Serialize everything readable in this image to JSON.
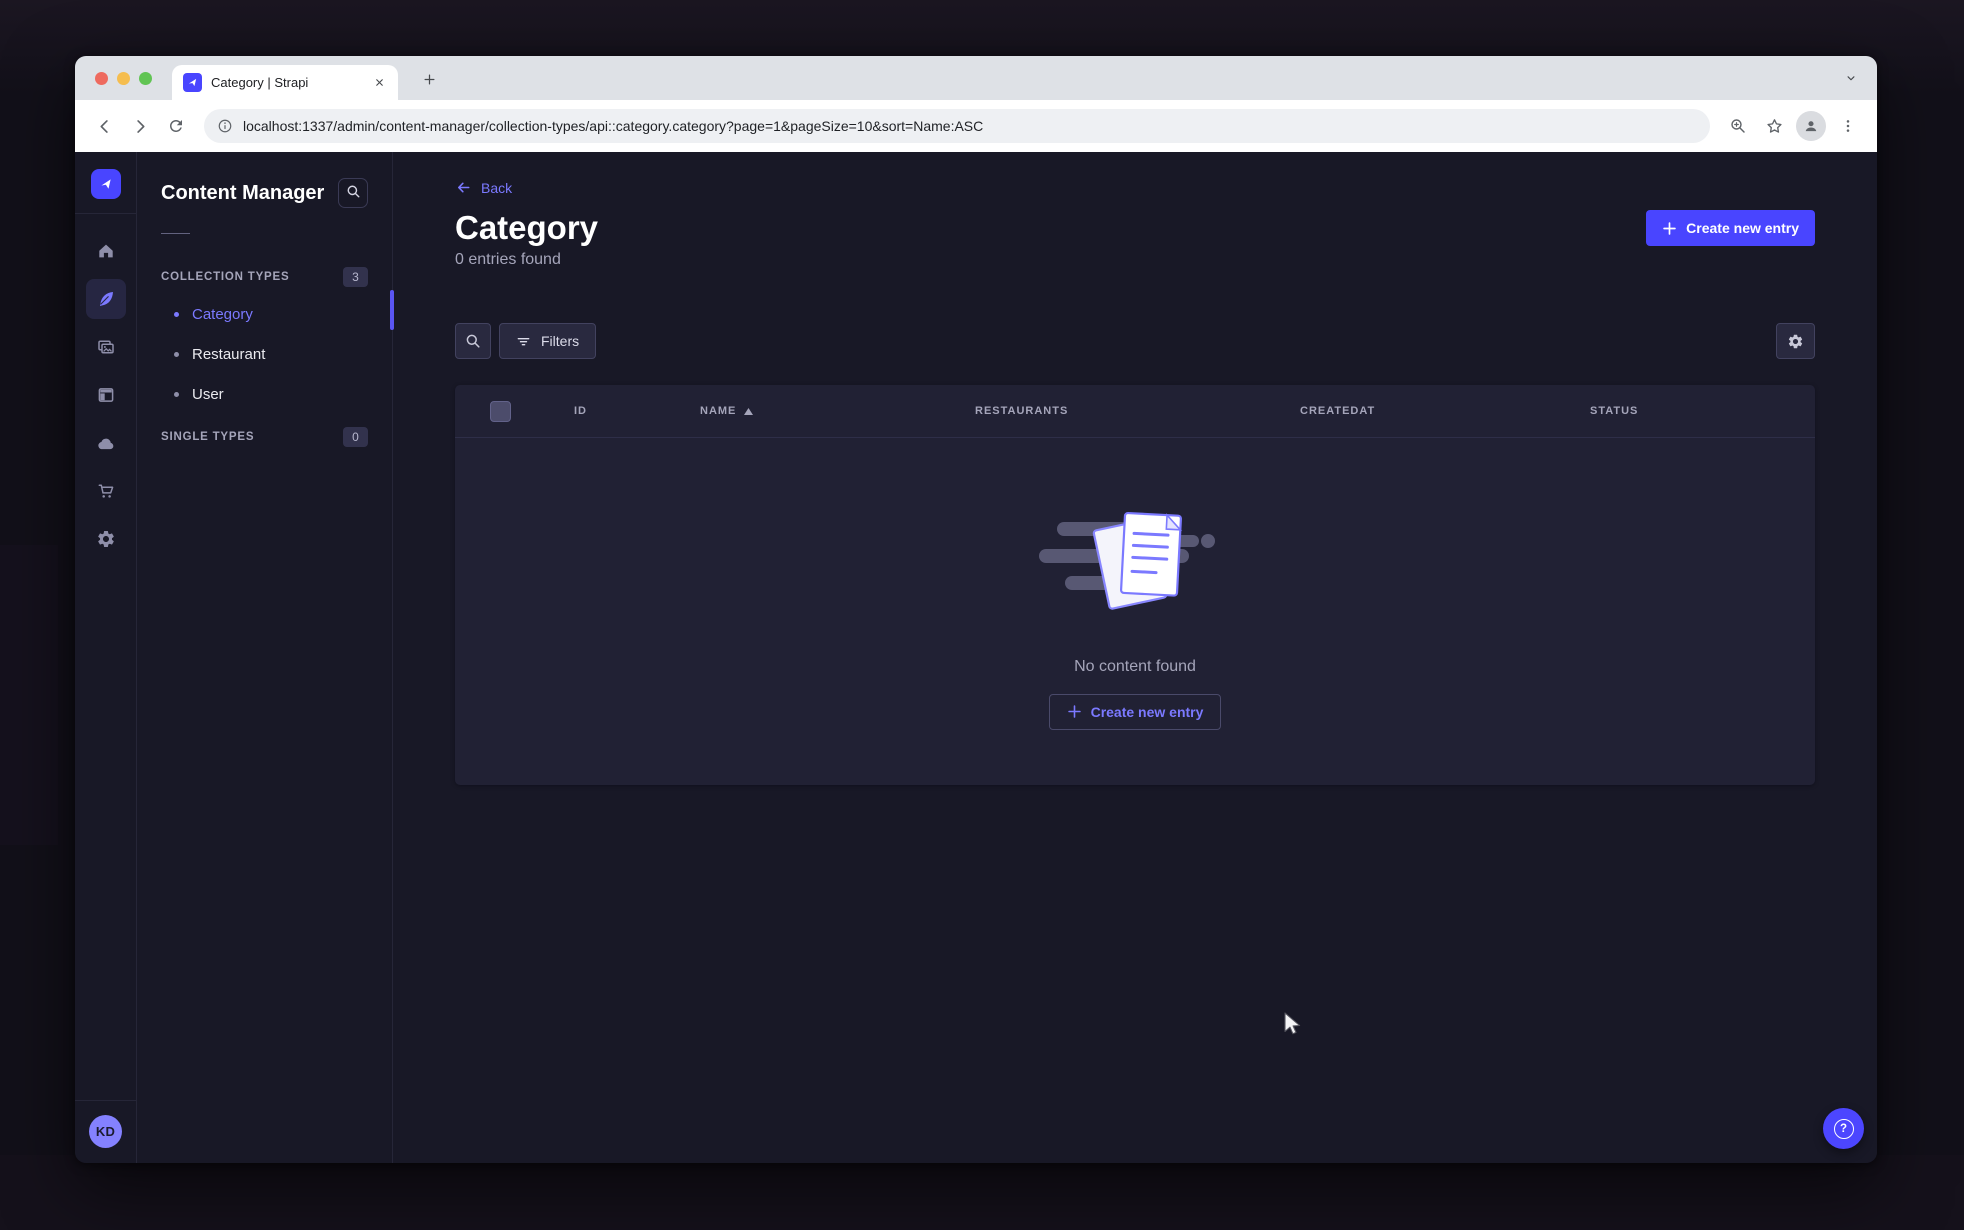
{
  "browser": {
    "tab_title": "Category | Strapi",
    "url": "localhost:1337/admin/content-manager/collection-types/api::category.category?page=1&pageSize=10&sort=Name:ASC"
  },
  "sidebar": {
    "avatar_initials": "KD"
  },
  "panel": {
    "title": "Content Manager",
    "collection_types": {
      "label": "COLLECTION TYPES",
      "badge": "3",
      "items": [
        {
          "label": "Category",
          "active": true
        },
        {
          "label": "Restaurant",
          "active": false
        },
        {
          "label": "User",
          "active": false
        }
      ]
    },
    "single_types": {
      "label": "SINGLE TYPES",
      "badge": "0"
    }
  },
  "main": {
    "back_label": "Back",
    "title": "Category",
    "subtitle": "0 entries found",
    "create_button_label": "Create new entry",
    "filters_label": "Filters",
    "table_headers": [
      "ID",
      "NAME",
      "RESTAURANTS",
      "CREATEDAT",
      "STATUS"
    ],
    "sorted_column": "NAME",
    "sort_direction": "ASC",
    "empty_message": "No content found",
    "empty_create_label": "Create new entry"
  },
  "icons": {
    "help": "?"
  },
  "colors": {
    "primary": "#4945ff",
    "link": "#7b79ff",
    "app_background": "#181826",
    "card_background": "#212134",
    "text_muted": "#a5a5ba"
  }
}
